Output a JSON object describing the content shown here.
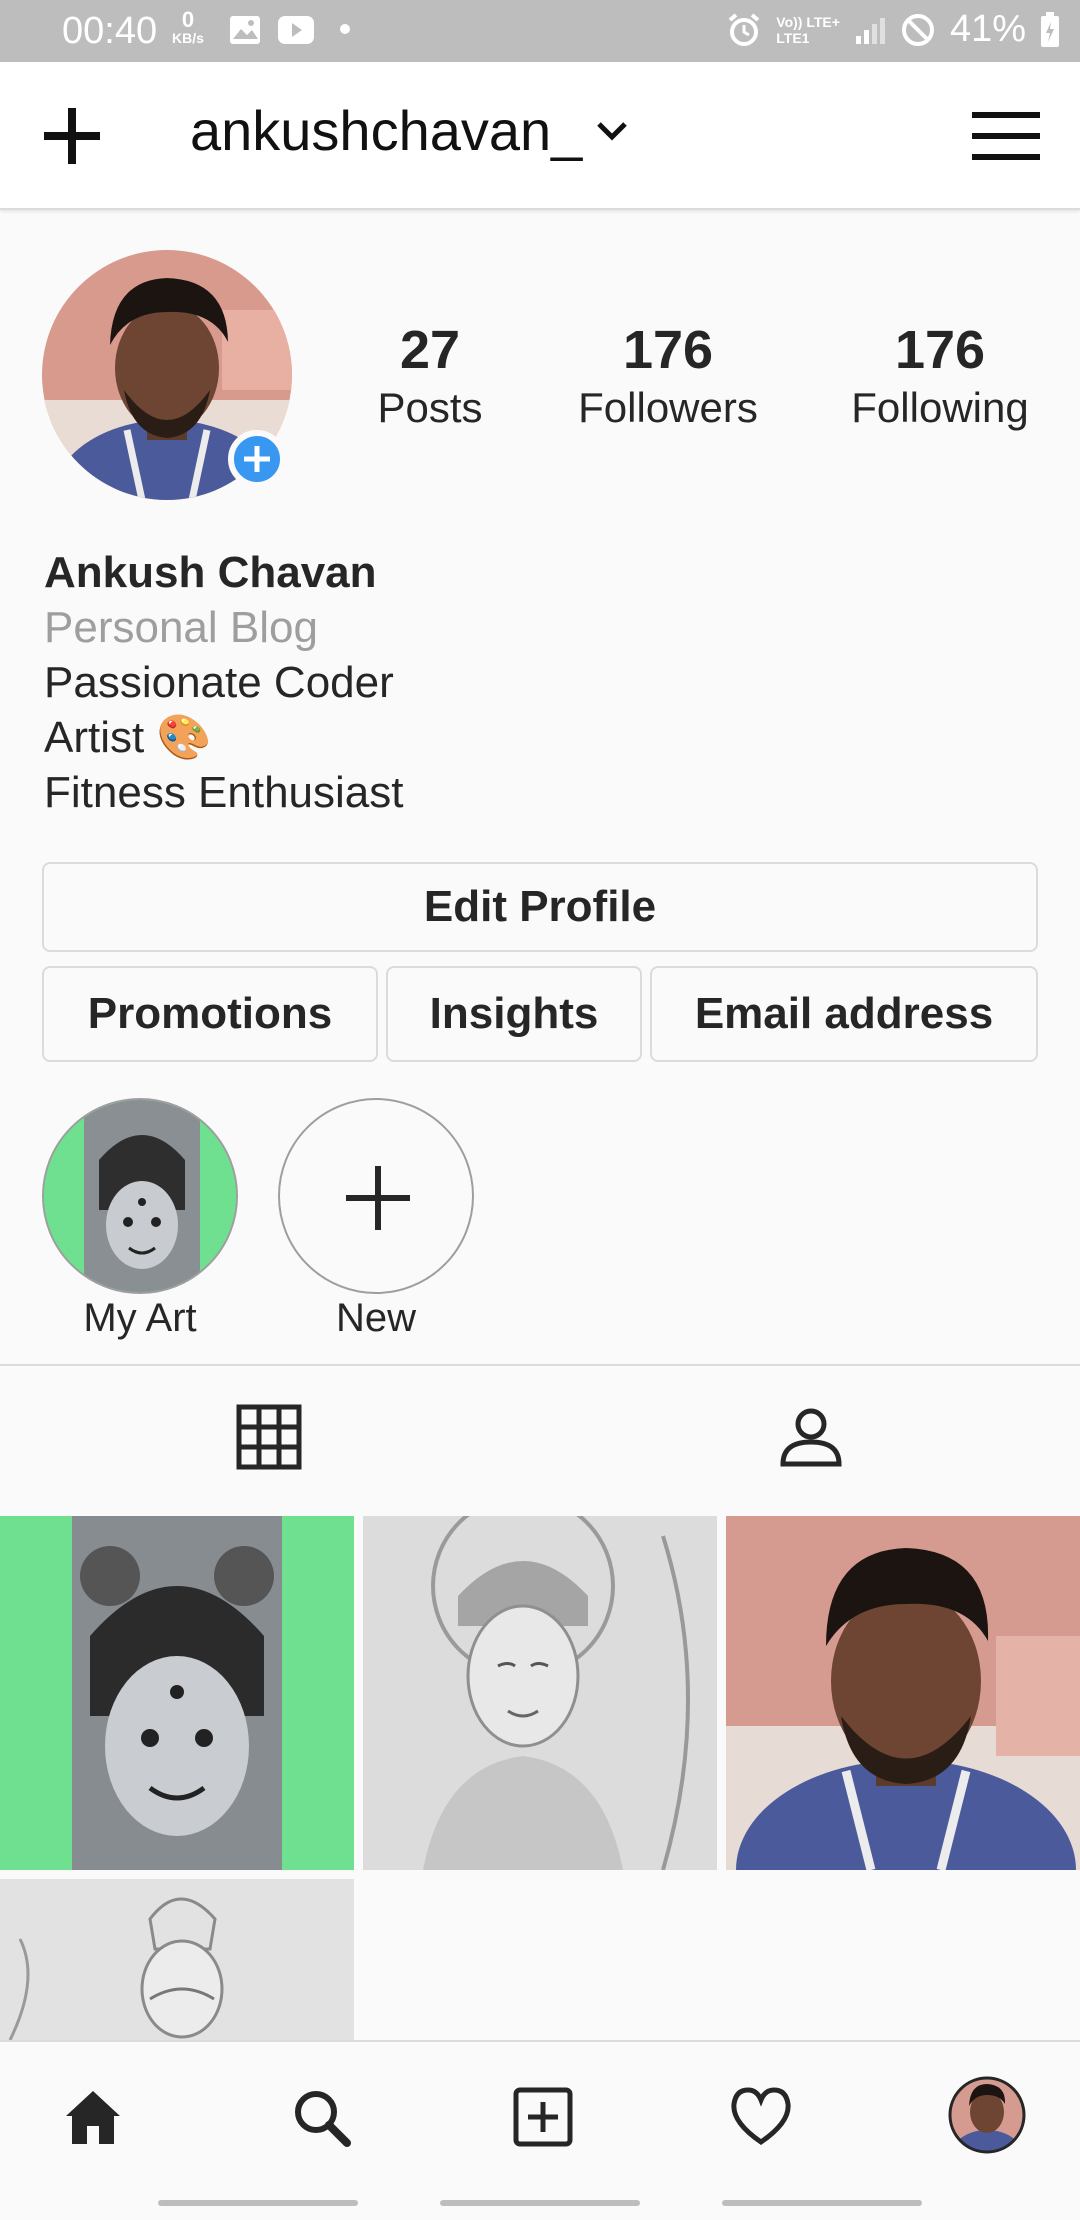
{
  "status_bar": {
    "time": "00:40",
    "net_speed_value": "0",
    "net_speed_unit": "KB/s",
    "network_top": "Vo)) LTE+",
    "network_bottom": "LTE1",
    "battery": "41%",
    "icons": [
      "gallery-icon",
      "youtube-icon",
      "dot-icon",
      "alarm-icon",
      "signal-icon",
      "dnd-icon",
      "battery-icon"
    ]
  },
  "header": {
    "username": "ankushchavan_",
    "icons": [
      "plus-icon",
      "chevron-down-icon",
      "hamburger-menu-icon"
    ]
  },
  "profile": {
    "stats": [
      {
        "value": "27",
        "label": "Posts"
      },
      {
        "value": "176",
        "label": "Followers"
      },
      {
        "value": "176",
        "label": "Following"
      }
    ],
    "name": "Ankush Chavan",
    "category": "Personal Blog",
    "bio_lines": [
      "Passionate Coder",
      "Artist 🎨",
      "Fitness Enthusiast"
    ]
  },
  "buttons": {
    "edit_profile": "Edit Profile",
    "promotions": "Promotions",
    "insights": "Insights",
    "email": "Email address"
  },
  "highlights": [
    {
      "label": "My Art"
    },
    {
      "label": "New"
    }
  ],
  "tabs": [
    "grid-icon",
    "tagged-person-icon"
  ],
  "posts": [
    "drawing-krishna",
    "drawing-rama",
    "selfie",
    "drawing-warrior"
  ],
  "bottom_nav": [
    "home-icon",
    "search-icon",
    "new-post-icon",
    "heart-icon",
    "profile-avatar"
  ],
  "colors": {
    "accent_blue": "#3897f0",
    "highlight_green": "#6ee08f",
    "status_bar": "#bdbdbd",
    "border": "#dbdbdb"
  }
}
